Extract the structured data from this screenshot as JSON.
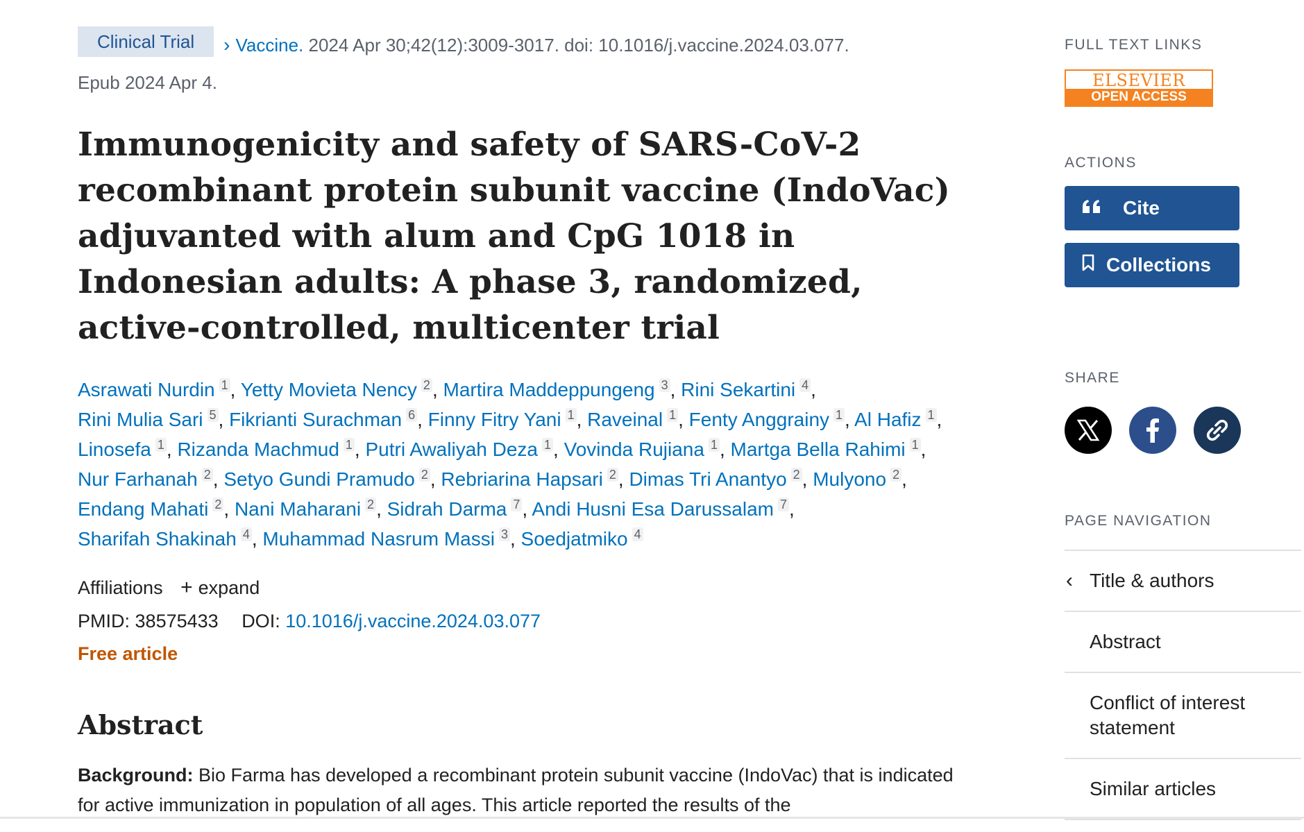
{
  "citation": {
    "pub_type": "Clinical Trial",
    "journal": "Vaccine.",
    "ref": "2024 Apr 30;42(12):3009-3017. doi: 10.1016/j.vaccine.2024.03.077.",
    "epub": "Epub 2024 Apr 4."
  },
  "title": "Immunogenicity and safety of SARS-CoV-2 recombinant protein subunit vaccine (IndoVac) adjuvanted with alum and CpG 1018 in Indonesian adults: A phase 3, randomized, active-controlled, multicenter trial",
  "authors": [
    {
      "name": "Asrawati Nurdin",
      "aff": "1"
    },
    {
      "name": "Yetty Movieta Nency",
      "aff": "2"
    },
    {
      "name": "Martira Maddeppungeng",
      "aff": "3"
    },
    {
      "name": "Rini Sekartini",
      "aff": "4"
    },
    {
      "name": "Rini Mulia Sari",
      "aff": "5"
    },
    {
      "name": "Fikrianti Surachman",
      "aff": "6"
    },
    {
      "name": "Finny Fitry Yani",
      "aff": "1"
    },
    {
      "name": "Raveinal",
      "aff": "1"
    },
    {
      "name": "Fenty Anggrainy",
      "aff": "1"
    },
    {
      "name": "Al Hafiz",
      "aff": "1"
    },
    {
      "name": "Linosefa",
      "aff": "1"
    },
    {
      "name": "Rizanda Machmud",
      "aff": "1"
    },
    {
      "name": "Putri Awaliyah Deza",
      "aff": "1"
    },
    {
      "name": "Vovinda Rujiana",
      "aff": "1"
    },
    {
      "name": "Martga Bella Rahimi",
      "aff": "1"
    },
    {
      "name": "Nur Farhanah",
      "aff": "2"
    },
    {
      "name": "Setyo Gundi Pramudo",
      "aff": "2"
    },
    {
      "name": "Rebriarina Hapsari",
      "aff": "2"
    },
    {
      "name": "Dimas Tri Anantyo",
      "aff": "2"
    },
    {
      "name": "Mulyono",
      "aff": "2"
    },
    {
      "name": "Endang Mahati",
      "aff": "2"
    },
    {
      "name": "Nani Maharani",
      "aff": "2"
    },
    {
      "name": "Sidrah Darma",
      "aff": "7"
    },
    {
      "name": "Andi Husni Esa Darussalam",
      "aff": "7"
    },
    {
      "name": "Sharifah Shakinah",
      "aff": "4"
    },
    {
      "name": "Muhammad Nasrum Massi",
      "aff": "3"
    },
    {
      "name": "Soedjatmiko",
      "aff": "4"
    }
  ],
  "affiliations": {
    "label": "Affiliations",
    "expand": "expand"
  },
  "ids": {
    "pmid_label": "PMID:",
    "pmid": "38575433",
    "doi_label": "DOI:",
    "doi": "10.1016/j.vaccine.2024.03.077"
  },
  "free_article": "Free article",
  "abstract": {
    "heading": "Abstract",
    "background_label": "Background:",
    "background_text": " Bio Farma has developed a recombinant protein subunit vaccine (IndoVac) that is indicated for active immunization in population of all ages. This article reported the results of the"
  },
  "sidebar": {
    "full_text_heading": "FULL TEXT LINKS",
    "elsevier_top": "ELSEVIER",
    "elsevier_bottom": "OPEN ACCESS",
    "actions_heading": "ACTIONS",
    "cite_label": "Cite",
    "collections_label": "Collections",
    "share_heading": "SHARE",
    "page_nav_heading": "PAGE NAVIGATION",
    "nav_items": [
      "Title & authors",
      "Abstract",
      "Conflict of interest statement",
      "Similar articles"
    ]
  },
  "colors": {
    "link": "#0071bc",
    "button": "#205493",
    "free": "#c05600",
    "elsevier": "#f58220",
    "facebook": "#2c4f8c",
    "x": "#000000"
  }
}
